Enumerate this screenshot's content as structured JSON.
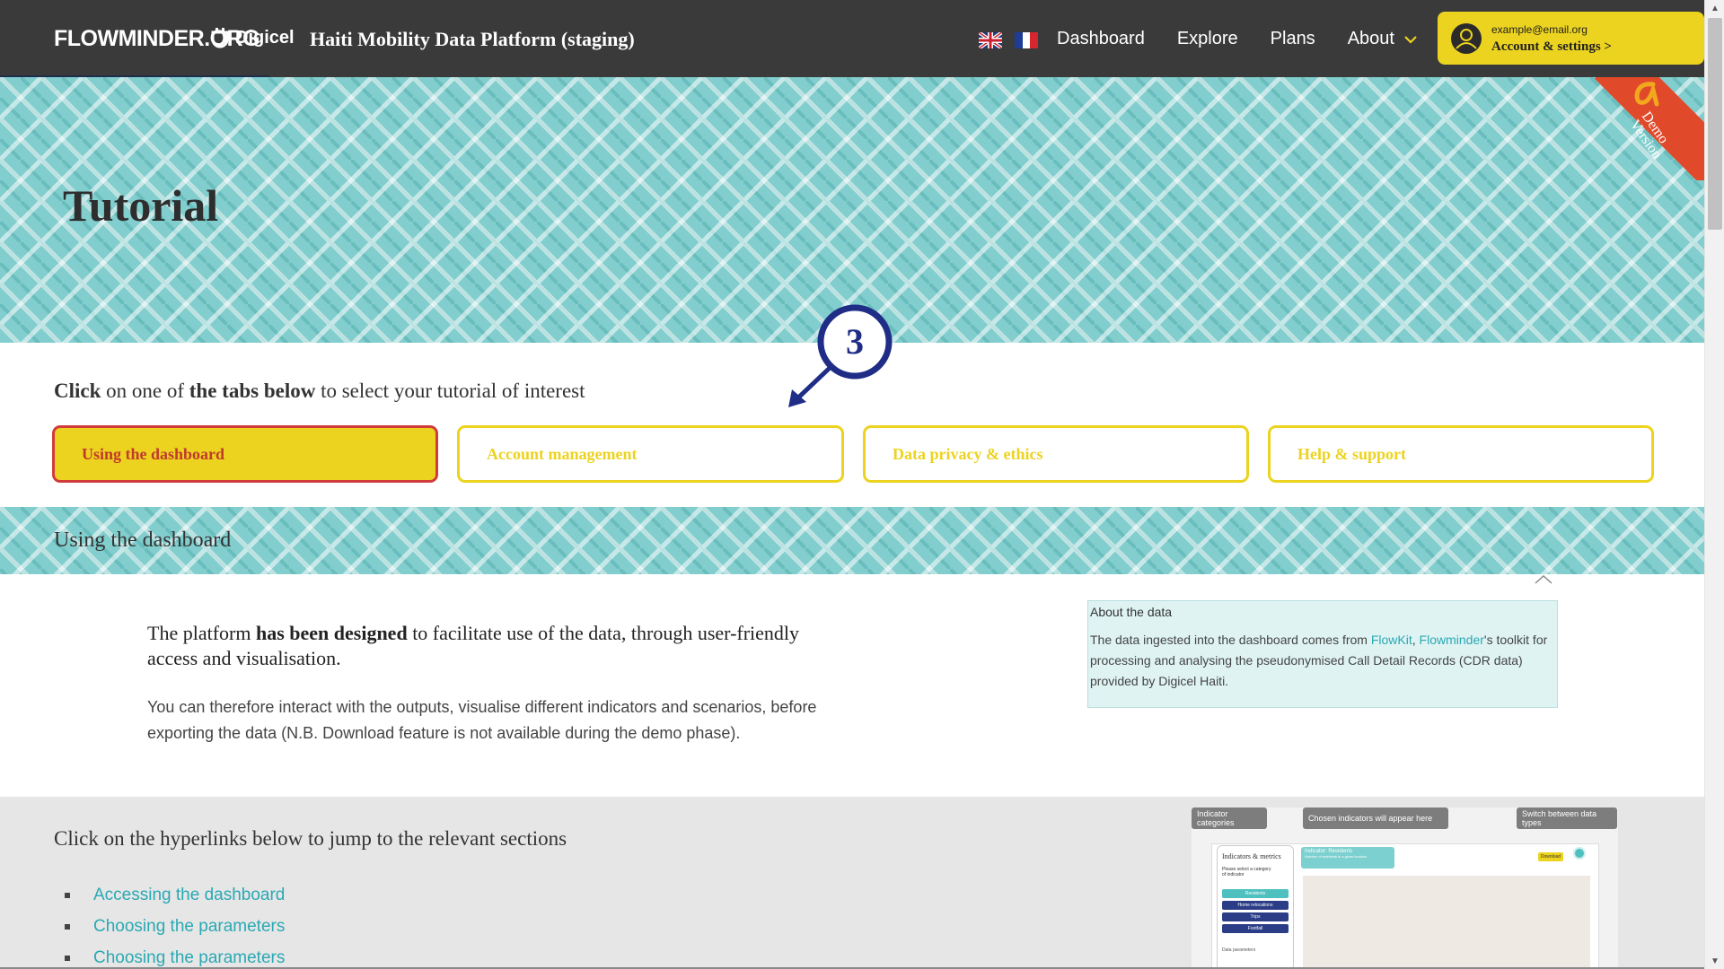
{
  "header": {
    "brand": "FLOWMINDER.ORG",
    "partner": "Digicel",
    "app_title": "Haiti Mobility Data Platform (staging)",
    "flags": [
      "uk-flag-icon",
      "france-flag-icon"
    ],
    "nav": {
      "dashboard": "Dashboard",
      "explore": "Explore",
      "plans": "Plans",
      "about": "About"
    },
    "account": {
      "email": "example@email.org",
      "link": "Account & settings >"
    }
  },
  "hero": {
    "title": "Tutorial",
    "ribbon": "Demo\nVersion"
  },
  "callout": {
    "number": "3"
  },
  "tabs": {
    "intro_prefix": "Click",
    "intro_mid1": " on one of ",
    "intro_bold": "the tabs below",
    "intro_rest": " to select your tutorial of interest",
    "items": [
      {
        "label": "Using the dashboard",
        "active": true
      },
      {
        "label": "Account management",
        "active": false
      },
      {
        "label": "Data privacy & ethics",
        "active": false
      },
      {
        "label": "Help & support",
        "active": false
      }
    ]
  },
  "section": {
    "title": "Using the dashboard",
    "lead_part1": "The platform ",
    "lead_bold": "has been designed",
    "lead_part2": " to facilitate use of the data, through user-friendly access and visualisation.",
    "body": "You can therefore interact with the outputs, visualise different indicators and scenarios, before exporting the data (N.B. Download feature is not available during the demo phase)."
  },
  "about_box": {
    "title": "About the data",
    "text_before": "The data ingested into the dashboard comes from ",
    "link1": "FlowKit",
    "comma": ", ",
    "link2": "Flowminder",
    "text_after": "'s toolkit for processing and analysing the pseudonymised Call Detail Records (CDR data) provided by Digicel Haiti."
  },
  "hyperlinks": {
    "title": "Click on the hyperlinks below to jump to the relevant sections",
    "items": [
      "Accessing the dashboard",
      "Choosing the parameters",
      "Choosing the parameters"
    ]
  },
  "preview": {
    "tips": [
      "Indicator categories",
      "Chosen indicators will appear here",
      "Switch between data types"
    ],
    "side_title": "Indicators & metrics",
    "side_sub": "Please select a category of indicator",
    "pills": [
      "Residents",
      "Home relocations",
      "Trips",
      "Footfall"
    ],
    "side_foot": "Data parameters",
    "ind_title": "Indicator: Residents",
    "ind_sub": "Number of residents in a given location",
    "button": "Download"
  },
  "colors": {
    "accent_yellow": "#ecd31f",
    "teal": "#82cdcd",
    "link_teal": "#2aa9b3",
    "active_border": "#d23b3b",
    "navy": "#1f2d87",
    "ribbon_red": "#e04a2b"
  }
}
